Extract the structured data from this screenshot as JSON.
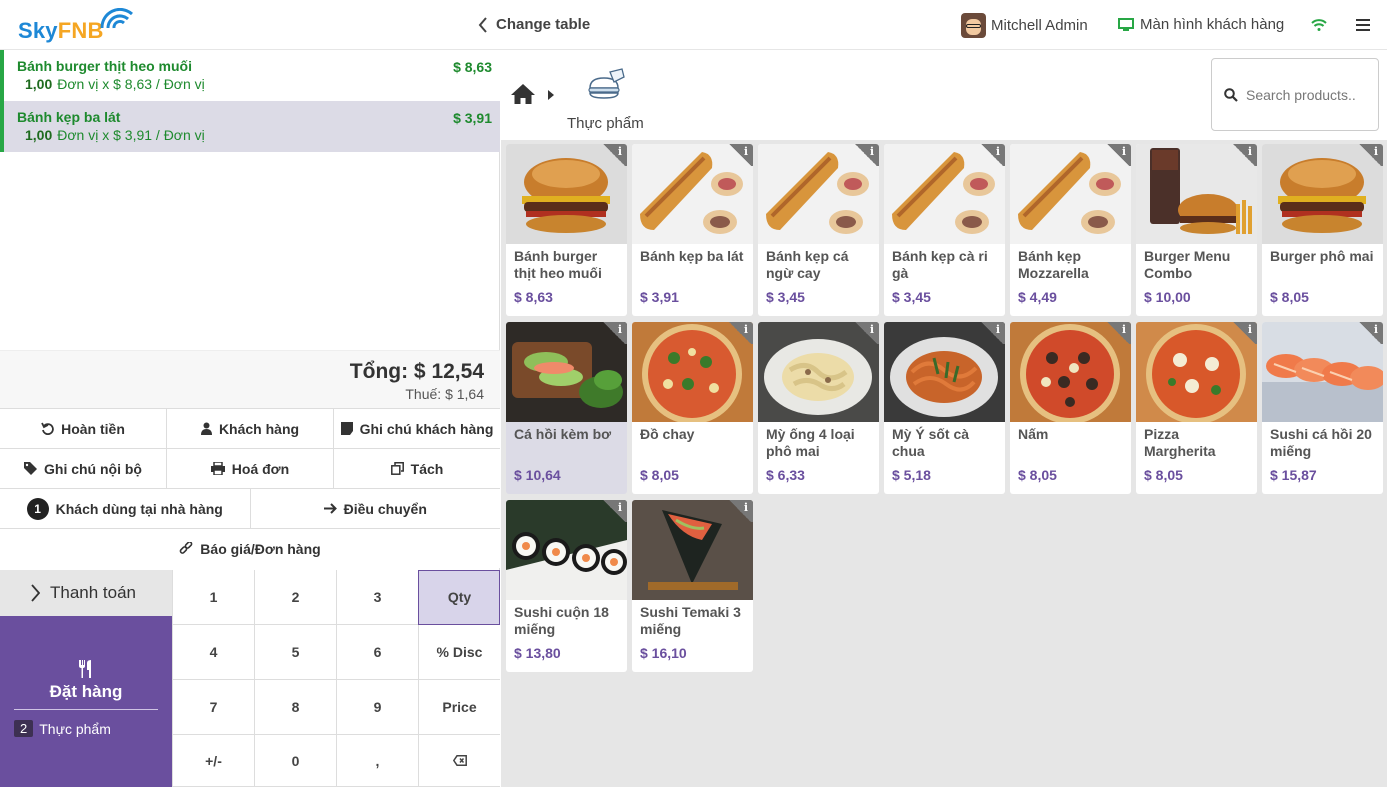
{
  "header": {
    "logo_sky": "Sky",
    "logo_fnb": "FNB",
    "change_table": "Change table",
    "user": "Mitchell Admin",
    "customer_screen": "Màn hình khách hàng"
  },
  "order": {
    "lines": [
      {
        "name": "Bánh burger thịt heo muối",
        "price": "$ 8,63",
        "qty": "1,00",
        "detail": "Đơn vị x $ 8,63 / Đơn vị"
      },
      {
        "name": "Bánh kẹp ba lát",
        "price": "$ 3,91",
        "qty": "1,00",
        "detail": "Đơn vị x $ 3,91 / Đơn vị"
      }
    ],
    "total": "Tổng: $ 12,54",
    "tax": "Thuế: $ 1,64"
  },
  "controls": {
    "refund": "Hoàn tiền",
    "customer": "Khách hàng",
    "customer_note": "Ghi chú khách hàng",
    "internal_note": "Ghi chú nội bộ",
    "invoice": "Hoá đơn",
    "split": "Tách",
    "guests_count": "1",
    "guests": "Khách dùng tại nhà hàng",
    "transfer": "Điều chuyển",
    "quotation": "Báo giá/Đơn hàng"
  },
  "payment": {
    "pay_label": "Thanh toán",
    "order_label": "Đặt hàng",
    "category_count": "2",
    "category_name": "Thực phẩm"
  },
  "numpad": [
    "1",
    "2",
    "3",
    "Qty",
    "4",
    "5",
    "6",
    "% Disc",
    "7",
    "8",
    "9",
    "Price",
    "+/-",
    "0",
    ",",
    ""
  ],
  "catalog": {
    "category": "Thực phẩm",
    "search_placeholder": "Search products..",
    "products": [
      {
        "name": "Bánh burger thịt heo muối",
        "price": "$ 8,63",
        "img": "burger"
      },
      {
        "name": "Bánh kẹp ba lát",
        "price": "$ 3,91",
        "img": "sandwich"
      },
      {
        "name": "Bánh kẹp cá ngừ cay",
        "price": "$ 3,45",
        "img": "sandwich"
      },
      {
        "name": "Bánh kẹp cà ri gà",
        "price": "$ 3,45",
        "img": "sandwich"
      },
      {
        "name": "Bánh kẹp Mozzarella",
        "price": "$ 4,49",
        "img": "sandwich"
      },
      {
        "name": "Burger Menu Combo",
        "price": "$ 10,00",
        "img": "combo"
      },
      {
        "name": "Burger phô mai",
        "price": "$ 8,05",
        "img": "burger"
      },
      {
        "name": "Cá hồi kèm bơ",
        "price": "$ 10,64",
        "img": "salmon-avocado"
      },
      {
        "name": "Đồ chay",
        "price": "$ 8,05",
        "img": "pizza-veg"
      },
      {
        "name": "Mỳ ống 4 loại phô mai",
        "price": "$ 6,33",
        "img": "pasta"
      },
      {
        "name": "Mỳ Ý sốt cà chua",
        "price": "$ 5,18",
        "img": "spaghetti"
      },
      {
        "name": "Nấm",
        "price": "$ 8,05",
        "img": "pizza-mushroom"
      },
      {
        "name": "Pizza Margherita",
        "price": "$ 8,05",
        "img": "pizza"
      },
      {
        "name": "Sushi cá hồi 20 miếng",
        "price": "$ 15,87",
        "img": "sushi-salmon"
      },
      {
        "name": "Sushi cuộn 18 miếng",
        "price": "$ 13,80",
        "img": "sushi-roll"
      },
      {
        "name": "Sushi Temaki 3 miếng",
        "price": "$ 16,10",
        "img": "temaki"
      }
    ]
  }
}
